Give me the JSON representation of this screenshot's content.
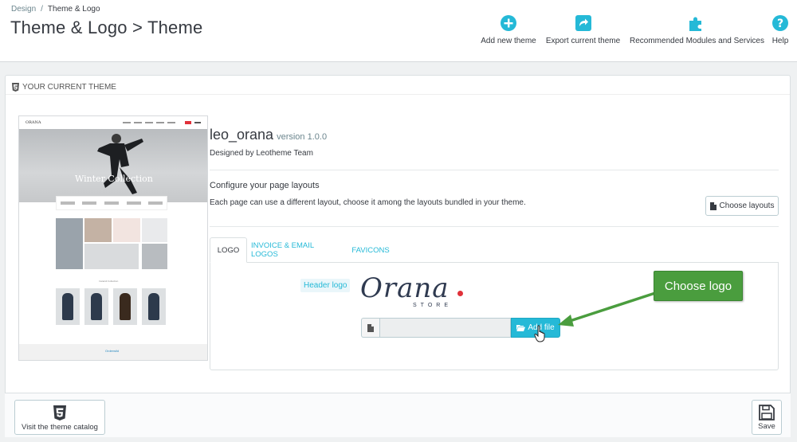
{
  "breadcrumb": {
    "parent": "Design",
    "current": "Theme & Logo"
  },
  "page_title": "Theme & Logo > Theme",
  "toolbar": [
    {
      "label": "Add new theme",
      "icon": "plus-circle-icon"
    },
    {
      "label": "Export current theme",
      "icon": "share-icon"
    },
    {
      "label": "Recommended Modules and Services",
      "icon": "puzzle-icon"
    },
    {
      "label": "Help",
      "icon": "help-icon"
    }
  ],
  "panel": {
    "heading": "YOUR CURRENT THEME",
    "theme_name": "leo_orana",
    "theme_version": "version 1.0.0",
    "designed_by": "Designed by Leotheme Team",
    "configure_title": "Configure your page layouts",
    "configure_desc": "Each page can use a different layout, choose it among the layouts bundled in your theme.",
    "choose_layouts_label": "Choose layouts"
  },
  "preview": {
    "logo": "ORANA",
    "hero_text": "Winter Collection",
    "section_title": "Instarsil Collection",
    "footer_text": "Orderwild"
  },
  "tabs": [
    {
      "label": "LOGO",
      "active": true
    },
    {
      "label": "INVOICE & EMAIL LOGOS",
      "active": false
    },
    {
      "label": "FAVICONS",
      "active": false
    }
  ],
  "logo_tab": {
    "header_logo_label": "Header logo",
    "logo_text": "Orana",
    "logo_subtext": "STORE",
    "add_file_label": "Add file"
  },
  "callout": {
    "text": "Choose logo"
  },
  "footer": {
    "visit_label": "Visit the theme catalog",
    "save_label": "Save"
  },
  "colors": {
    "accent": "#25b9d7",
    "callout": "#4a9d3e",
    "logo_dot": "#e0313a"
  }
}
